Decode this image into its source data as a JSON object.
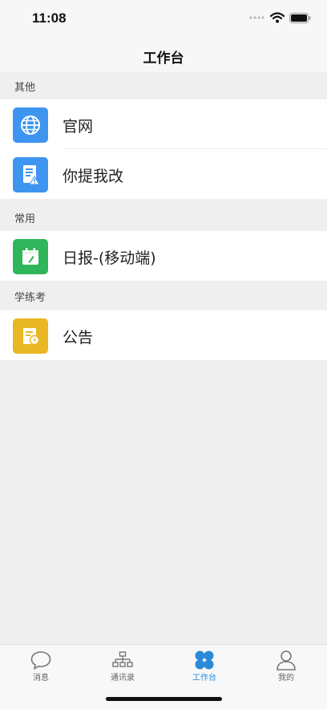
{
  "status": {
    "time": "11:08"
  },
  "nav": {
    "title": "工作台"
  },
  "sections": [
    {
      "title": "其他",
      "items": [
        {
          "label": "官网",
          "icon": "globe-icon",
          "color": "#3d95f0"
        },
        {
          "label": "你提我改",
          "icon": "document-warning-icon",
          "color": "#3d95f0"
        }
      ]
    },
    {
      "title": "常用",
      "items": [
        {
          "label": "日报-(移动端)",
          "icon": "calendar-edit-icon",
          "color": "#2fb55a"
        }
      ]
    },
    {
      "title": "学练考",
      "items": [
        {
          "label": "公告",
          "icon": "notice-yen-icon",
          "color": "#e9b723"
        }
      ]
    }
  ],
  "tabs": [
    {
      "label": "消息",
      "icon": "chat-bubble-icon"
    },
    {
      "label": "通讯录",
      "icon": "org-chart-icon"
    },
    {
      "label": "工作台",
      "icon": "workbench-grid-icon",
      "active": true
    },
    {
      "label": "我的",
      "icon": "person-icon"
    }
  ],
  "colors": {
    "accent": "#2a8ad8",
    "background": "#efefef"
  }
}
